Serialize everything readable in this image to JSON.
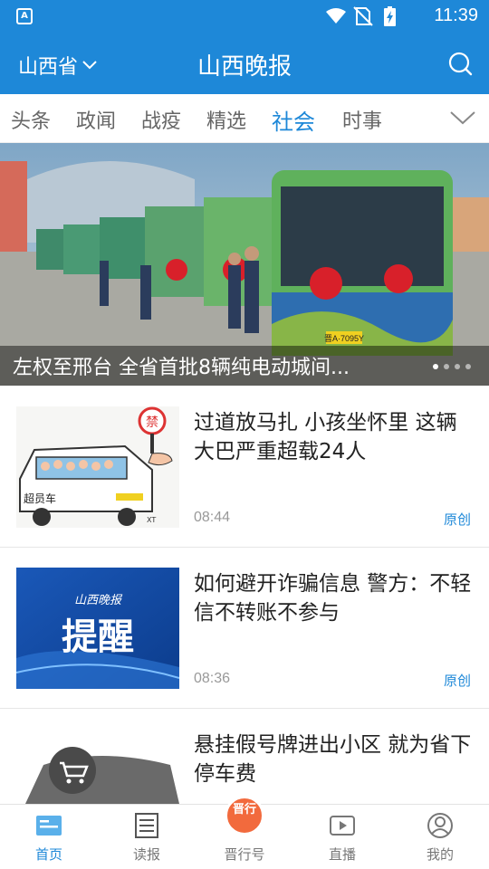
{
  "status_bar": {
    "time": "11:39",
    "app_badge": "A"
  },
  "header": {
    "province": "山西省",
    "title": "山西晚报"
  },
  "tabs": [
    {
      "label": "头条"
    },
    {
      "label": "政闻"
    },
    {
      "label": "战疫"
    },
    {
      "label": "精选"
    },
    {
      "label": "社会",
      "active": true
    },
    {
      "label": "时事"
    }
  ],
  "banner": {
    "caption": "左权至邢台 全省首批8辆纯电动城间...",
    "dots": 4,
    "active_dot": 1,
    "plate_text": "晋A·7095Y"
  },
  "news": [
    {
      "title": "过道放马扎 小孩坐怀里 这辆大巴严重超载24人",
      "time": "08:44",
      "tag": "原创",
      "thumb_text": {
        "sign": "禁",
        "bus": "超员车",
        "sig": "XT"
      }
    },
    {
      "title": "如何避开诈骗信息 警方：不轻信不转账不参与",
      "time": "08:36",
      "tag": "原创",
      "thumb_text": {
        "logo": "山西晚报",
        "big": "提醒"
      }
    },
    {
      "title": "悬挂假号牌进出小区 就为省下停车费",
      "time": "",
      "tag": ""
    }
  ],
  "bottom_nav": [
    {
      "label": "首页",
      "icon": "home-news-icon",
      "active": true
    },
    {
      "label": "读报",
      "icon": "newspaper-icon"
    },
    {
      "label": "晋行号",
      "icon": "jinxing-badge-icon",
      "badge": "晋行"
    },
    {
      "label": "直播",
      "icon": "play-icon"
    },
    {
      "label": "我的",
      "icon": "user-icon"
    }
  ],
  "colors": {
    "brand": "#1e88d8",
    "badge": "#f26a3d"
  }
}
